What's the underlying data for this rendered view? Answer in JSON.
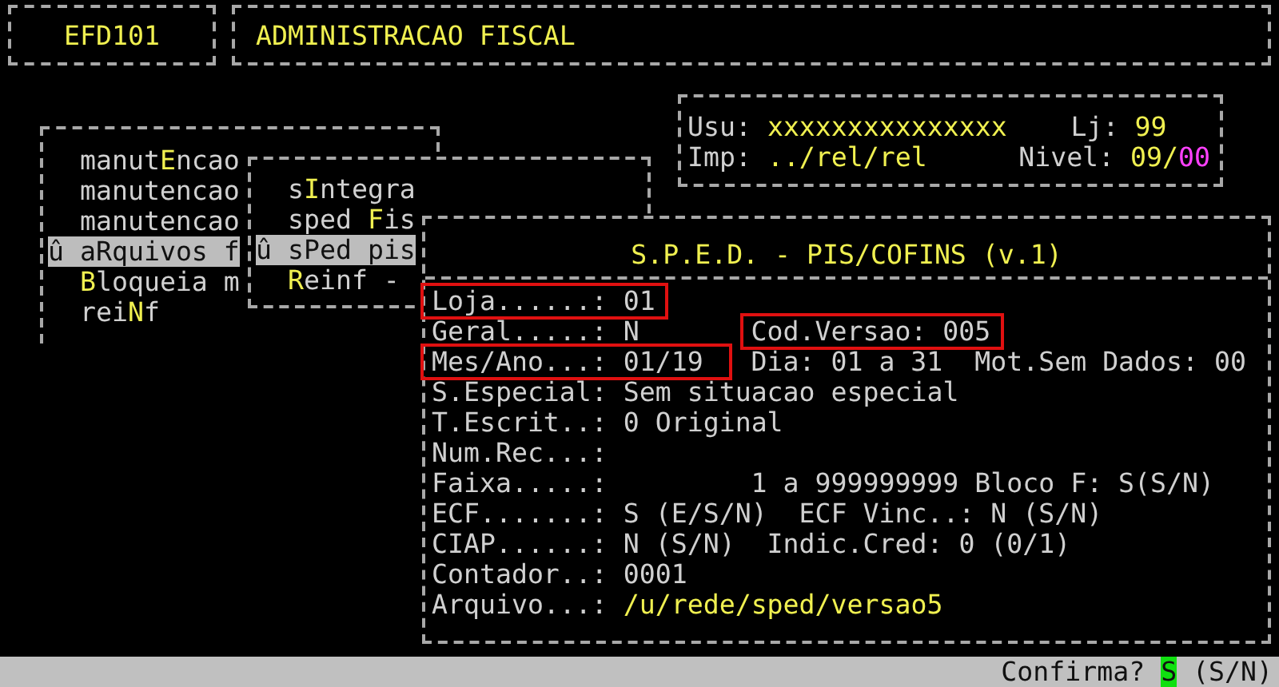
{
  "header": {
    "program_code": "EFD101",
    "title": "ADMINISTRACAO FISCAL"
  },
  "session": {
    "user_label": "Usu:",
    "user": "xxxxxxxxxxxxxxx",
    "store_label": "Lj:",
    "store": "99",
    "printer_label": "Imp:",
    "printer": "../rel/rel",
    "nivel_label": "Nivel:",
    "nivel": "09/",
    "nivel_suffix": "00"
  },
  "main_menu": [
    {
      "before": "manut",
      "key": "E",
      "after": "ncao",
      "selected": false
    },
    {
      "before": "manutencao",
      "selected": false
    },
    {
      "before": "manutencao",
      "selected": false
    },
    {
      "marker": "û",
      "before": "a",
      "key": "R",
      "after": "quivos f",
      "selected": true
    },
    {
      "key": "B",
      "after": "loqueia m",
      "selected": false
    },
    {
      "before": "rei",
      "key": "N",
      "after": "f",
      "selected": false
    }
  ],
  "sub_menu": [
    {
      "before": "s",
      "key": "I",
      "after": "ntegra",
      "selected": false
    },
    {
      "before": "sped ",
      "key": "F",
      "after": "is",
      "selected": false
    },
    {
      "marker": "û",
      "before": "s",
      "key": "P",
      "after": "ed pis",
      "selected": true
    },
    {
      "key": "R",
      "after": "einf -",
      "selected": false
    }
  ],
  "dialog": {
    "title": "S.P.E.D. - PIS/COFINS (v.1)",
    "rows": [
      [
        {
          "label": "Loja......:",
          "value": "01",
          "boxed": true
        }
      ],
      [
        {
          "label": "Geral.....:",
          "value": "N",
          "boxed": false
        },
        {
          "label": "Cod.Versao:",
          "value": "005",
          "boxed": true
        }
      ],
      [
        {
          "label": "Mes/Ano...:",
          "value": "01/19",
          "boxed": true
        },
        {
          "label": "Dia:",
          "value": "01 a 31",
          "boxed": false
        },
        {
          "label": "Mot.Sem Dados:",
          "value": "00",
          "boxed": false
        }
      ],
      [
        {
          "label": "S.Especial:",
          "value": "Sem situacao especial",
          "boxed": false
        }
      ],
      [
        {
          "label": "T.Escrit..:",
          "value": "0 Original",
          "boxed": false
        }
      ],
      [
        {
          "label": "Num.Rec...:",
          "boxed": false
        }
      ],
      [
        {
          "label": "Faixa.....:",
          "boxed": false
        },
        {
          "value": "1 a 999999999 Bloco F: S(S/N)",
          "boxed": false
        }
      ],
      [
        {
          "label": "ECF.......:",
          "value": "S (E/S/N)",
          "boxed": false
        },
        {
          "label": "ECF Vinc..:",
          "value": "N (S/N)",
          "boxed": false
        }
      ],
      [
        {
          "label": "CIAP......:",
          "value": "N (S/N)",
          "boxed": false
        },
        {
          "label": "Indic.Cred:",
          "value": "0 (0/1)",
          "boxed": false
        }
      ],
      [
        {
          "label": "Contador..:",
          "value": "0001",
          "boxed": false
        }
      ],
      [
        {
          "label": "Arquivo...:",
          "value": "/u/rede/sped/versao5",
          "boxed": false,
          "emphasis": true
        }
      ]
    ]
  },
  "status_bar": {
    "prompt": "Confirma?",
    "answer": "S",
    "options": "(S/N)"
  }
}
